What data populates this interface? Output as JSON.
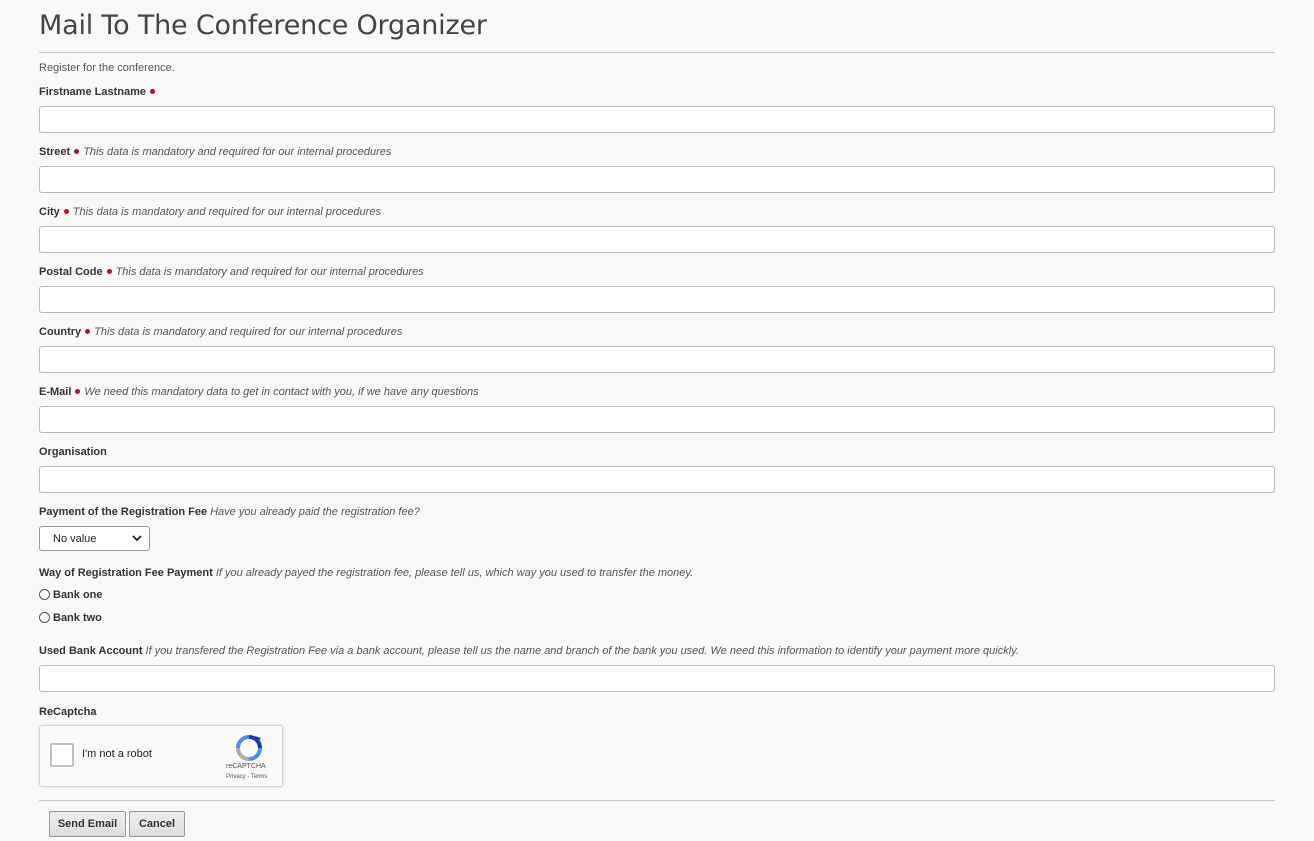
{
  "page": {
    "title": "Mail To The Conference Organizer",
    "intro": "Register for the conference."
  },
  "fields": {
    "name": {
      "label": "Firstname Lastname",
      "value": ""
    },
    "street": {
      "label": "Street",
      "hint": "This data is mandatory and required for our internal procedures",
      "value": ""
    },
    "city": {
      "label": "City",
      "hint": "This data is mandatory and required for our internal procedures",
      "value": ""
    },
    "postal": {
      "label": "Postal Code",
      "hint": "This data is mandatory and required for our internal procedures",
      "value": ""
    },
    "country": {
      "label": "Country",
      "hint": "This data is mandatory and required for our internal procedures",
      "value": ""
    },
    "email": {
      "label": "E-Mail",
      "hint": "We need this mandatory data to get in contact with you, if we have any questions",
      "value": ""
    },
    "organisation": {
      "label": "Organisation",
      "value": ""
    },
    "payment": {
      "label": "Payment of the Registration Fee",
      "hint": "Have you already paid the registration fee?",
      "selected": "No value"
    },
    "way": {
      "label": "Way of Registration Fee Payment",
      "hint": "If you already payed the registration fee, please tell us, which way you used to transfer the money.",
      "options": [
        "Bank one",
        "Bank two"
      ]
    },
    "bank_account": {
      "label": "Used Bank Account",
      "hint": "If you transfered the Registration Fee via a bank account, please tell us the name and branch of the bank you used. We need this information to identify your payment more quickly.",
      "value": ""
    },
    "recaptcha": {
      "label": "ReCaptcha",
      "checkbox_text": "I'm not a robot",
      "brand": "reCAPTCHA",
      "links": "Privacy - Terms"
    }
  },
  "buttons": {
    "send": "Send Email",
    "cancel": "Cancel"
  },
  "colors": {
    "required_dot": "#b11226",
    "background": "#f8f8f8"
  }
}
